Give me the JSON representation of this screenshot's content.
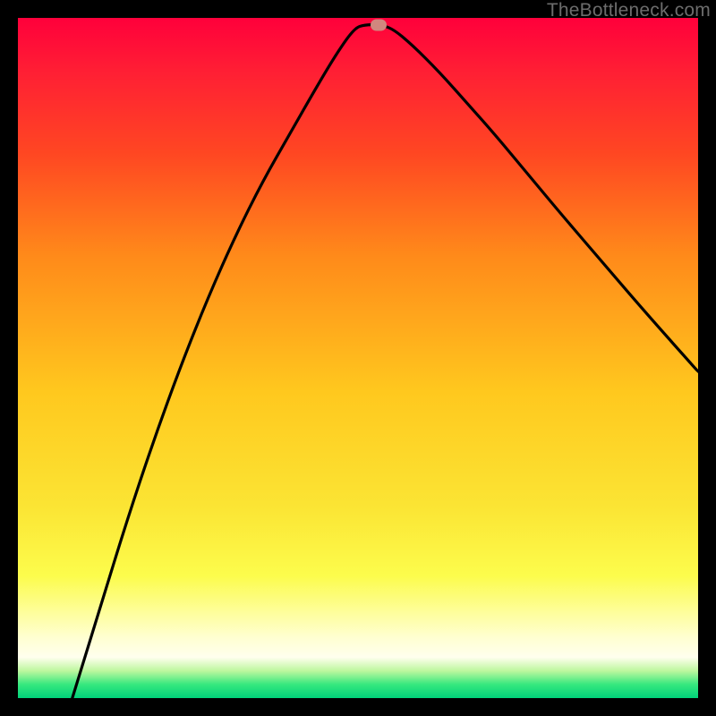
{
  "watermark": "TheBottleneck.com",
  "marker": {
    "x_pct": 53.0,
    "y_pct": 99.0
  },
  "chart_data": {
    "type": "line",
    "title": "",
    "xlabel": "",
    "ylabel": "",
    "xlim": [
      0,
      100
    ],
    "ylim": [
      0,
      100
    ],
    "series": [
      {
        "name": "curve",
        "x": [
          8,
          12,
          16,
          20,
          24,
          28,
          32,
          36,
          40,
          44,
          47,
          49.5,
          51,
          53,
          55,
          58,
          62,
          66,
          70,
          75,
          80,
          86,
          92,
          100
        ],
        "y": [
          0,
          13,
          26,
          38,
          49,
          59,
          68,
          76,
          83,
          90,
          95,
          98.5,
          99,
          99,
          98.5,
          96,
          92,
          87.5,
          83,
          77,
          71,
          64,
          57,
          48
        ]
      }
    ],
    "gradient_stops": [
      {
        "pct": 0,
        "color": "#ff003b"
      },
      {
        "pct": 20,
        "color": "#ff4722"
      },
      {
        "pct": 55,
        "color": "#ffc81e"
      },
      {
        "pct": 82,
        "color": "#fcfc4c"
      },
      {
        "pct": 96,
        "color": "#bdf79e"
      },
      {
        "pct": 100,
        "color": "#00d27a"
      }
    ],
    "marker": {
      "x": 53,
      "y": 99,
      "color": "#d1877e"
    }
  }
}
